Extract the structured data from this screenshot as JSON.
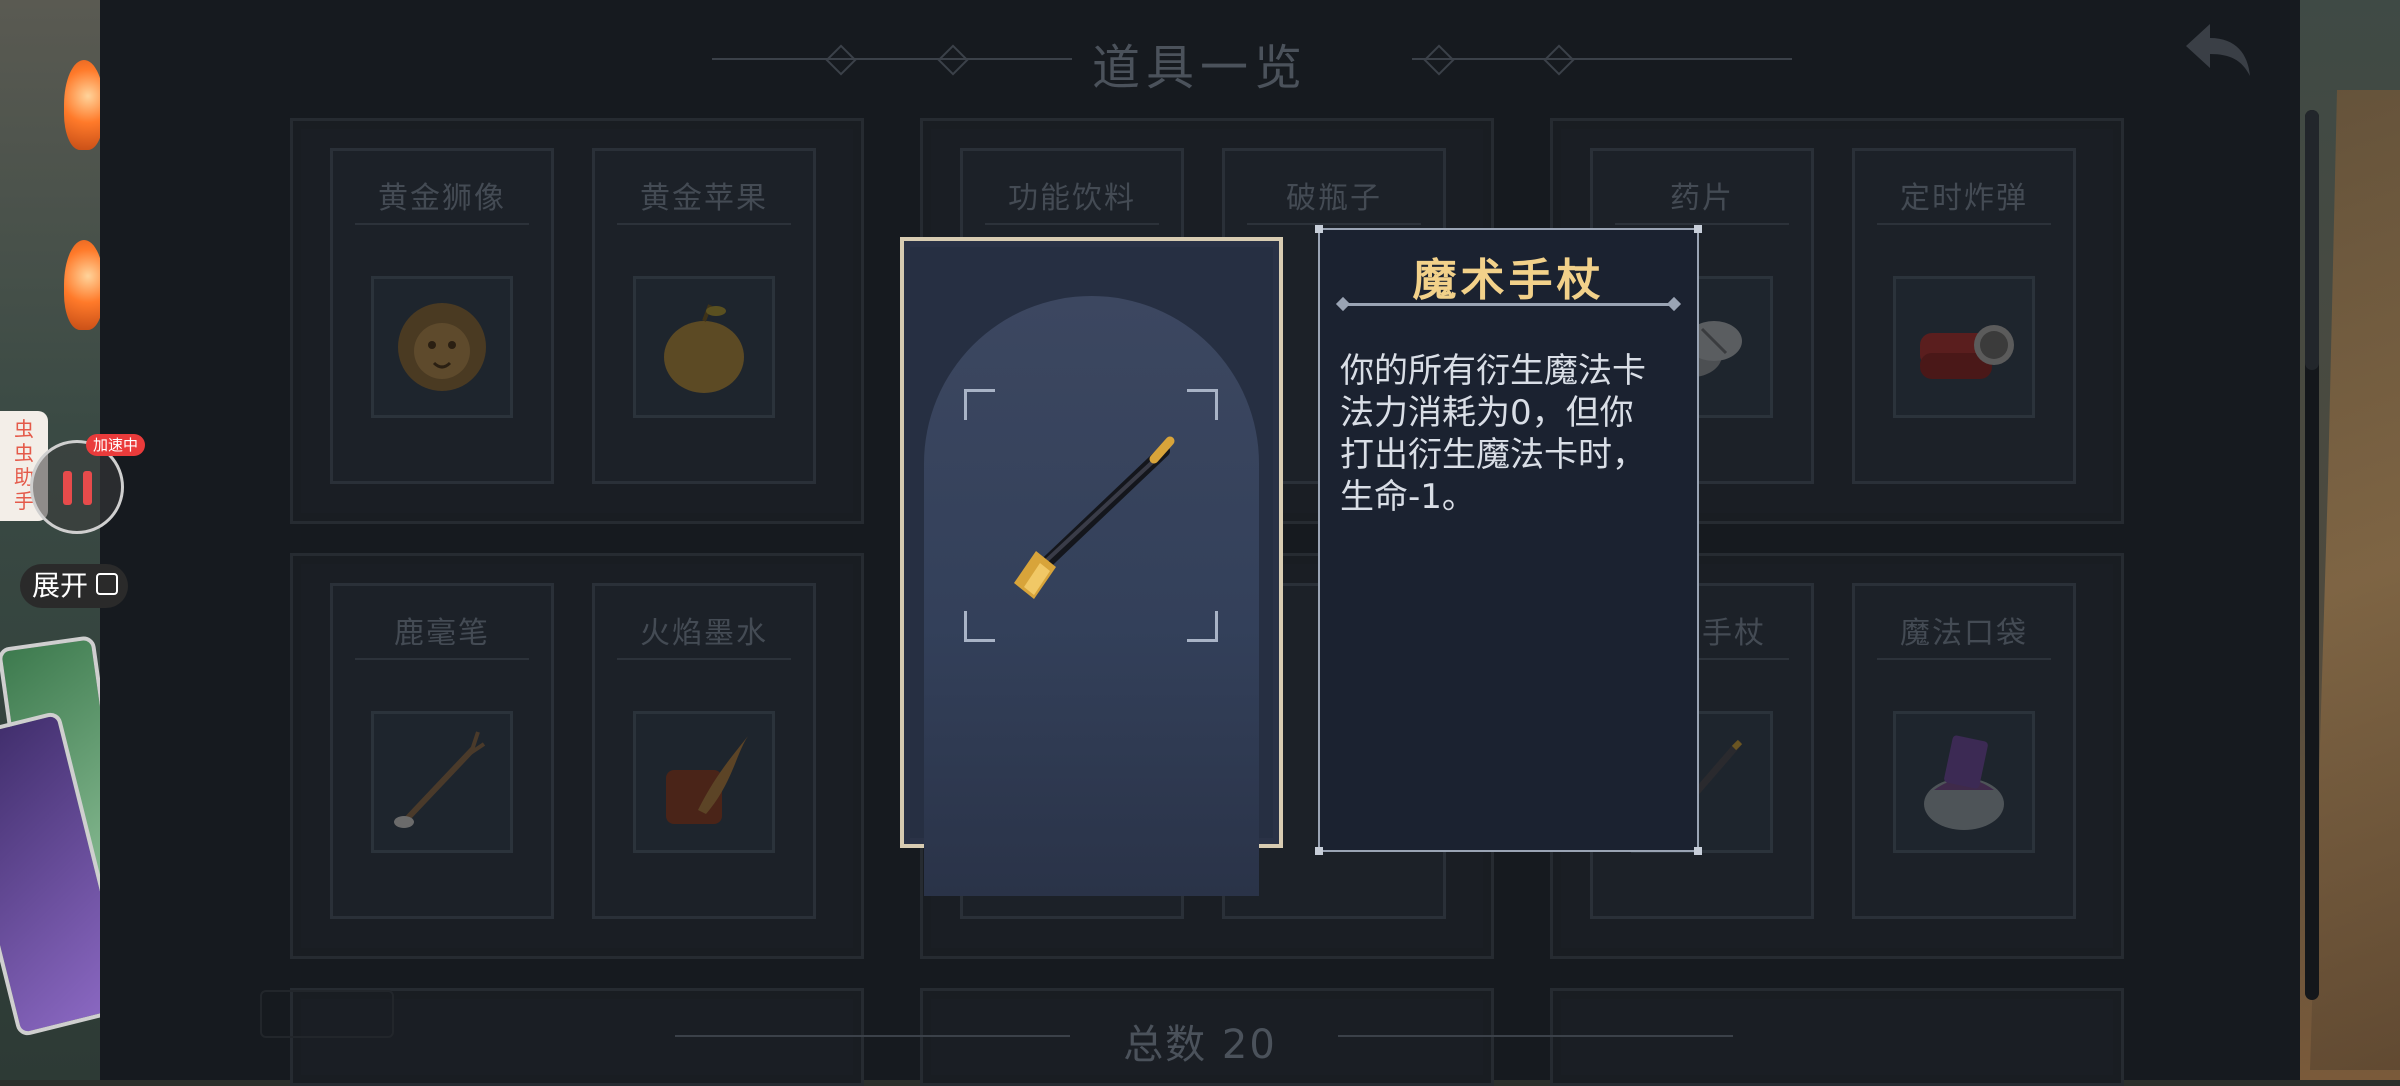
{
  "header": {
    "title": "道具一览"
  },
  "items_row1": [
    {
      "name": "黄金狮像",
      "icon": "golden-lion-icon"
    },
    {
      "name": "黄金苹果",
      "icon": "golden-apple-icon"
    },
    {
      "name": "功能饮料",
      "icon": "energy-drink-icon"
    },
    {
      "name": "破瓶子",
      "icon": "broken-bottle-icon"
    },
    {
      "name": "药片",
      "icon": "pills-icon"
    },
    {
      "name": "定时炸弹",
      "icon": "time-bomb-icon"
    }
  ],
  "items_row2": [
    {
      "name": "鹿毫笔",
      "icon": "antler-brush-icon"
    },
    {
      "name": "火焰墨水",
      "icon": "flame-ink-icon"
    },
    {
      "name": "",
      "icon": ""
    },
    {
      "name": "",
      "icon": ""
    },
    {
      "name": "魔术手杖",
      "icon": "magic-wand-icon"
    },
    {
      "name": "魔法口袋",
      "icon": "magic-pouch-icon"
    }
  ],
  "detail": {
    "name": "魔术手杖",
    "description": "你的所有衍生魔法卡\n法力消耗为0，但你\n打出衍生魔法卡时，\n生命-1。",
    "icon": "magic-wand-icon"
  },
  "footer": {
    "total": "总数 20"
  },
  "assistant": {
    "tab_label": "虫\n虫\n助\n手",
    "badge": "加速中",
    "expand_label": "展开"
  },
  "colors": {
    "title_gold": "#f2d18a",
    "badge_red": "#ea3b3b"
  }
}
